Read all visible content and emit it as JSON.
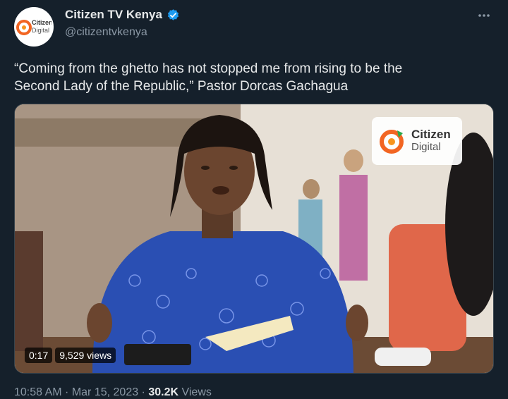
{
  "author": {
    "display_name": "Citizen TV Kenya",
    "handle": "@citizentvkenya",
    "avatar_text_line1": "Citizen",
    "avatar_text_line2": "Digital"
  },
  "tweet": {
    "text": "“Coming from the ghetto has not stopped me from rising to be the\nSecond Lady of the Republic,” Pastor Dorcas Gachagua"
  },
  "video": {
    "watermark_line1": "Citizen",
    "watermark_line2": "Digital",
    "duration": "0:17",
    "views": "9,529 views"
  },
  "meta": {
    "time": "10:58 AM",
    "date": "Mar 15, 2023",
    "separator": " · ",
    "view_count": "30.2K",
    "view_label": " Views"
  },
  "colors": {
    "background": "#15202b",
    "verified": "#1d9bf0",
    "brand_orange": "#f26522"
  }
}
